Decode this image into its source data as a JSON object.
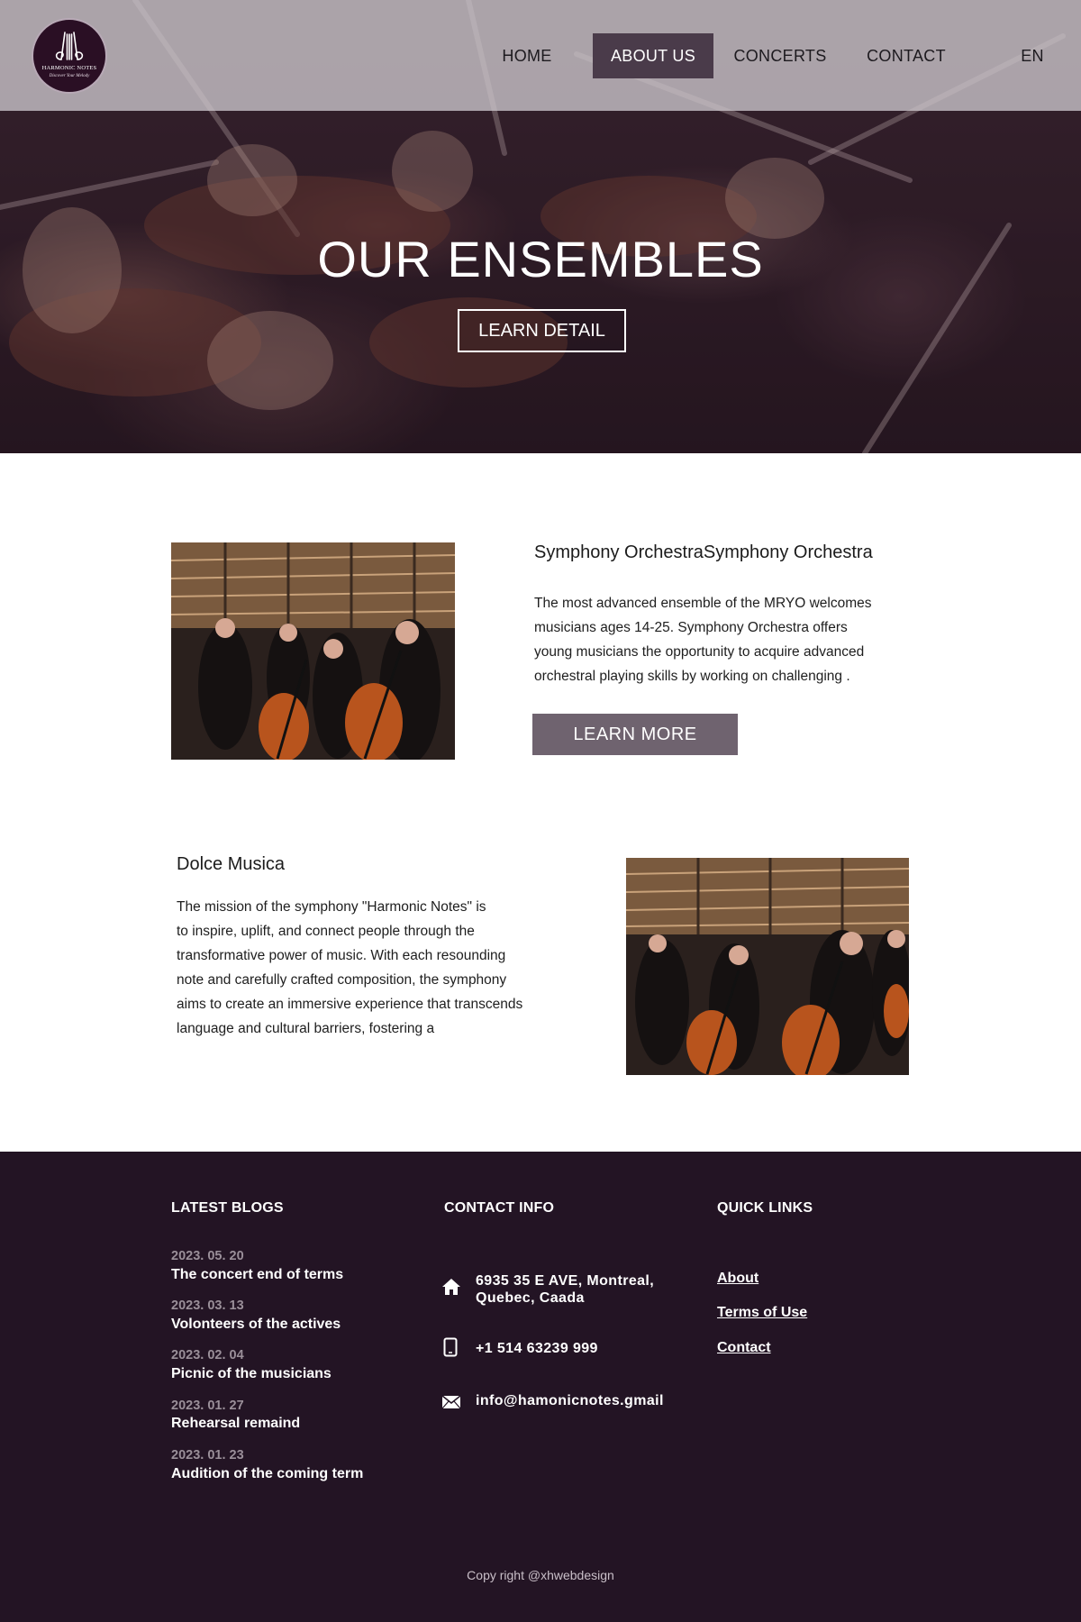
{
  "nav": {
    "logo": {
      "title": "HARMONIC NOTES",
      "tagline": "Discover Your Melody"
    },
    "items": [
      {
        "label": "HOME",
        "active": false
      },
      {
        "label": "ABOUT US",
        "active": true
      },
      {
        "label": "CONCERTS",
        "active": false
      },
      {
        "label": "CONTACT",
        "active": false
      },
      {
        "label": "EN",
        "active": false
      }
    ]
  },
  "hero": {
    "title": "OUR ENSEMBLES",
    "button_label": "LEARN DETAIL"
  },
  "ensembles": [
    {
      "title": "Symphony OrchestraSymphony Orchestra",
      "lines": [
        "The most advanced ensemble of the MRYO welcomes",
        "musicians ages 14-25. Symphony Orchestra offers",
        "young musicians the opportunity to acquire advanced",
        "orchestral playing skills by working on challenging ."
      ],
      "button_label": "LEARN MORE"
    },
    {
      "title": "Dolce Musica",
      "lines": [
        "The mission of the symphony \"Harmonic Notes\" is",
        "to inspire, uplift, and connect people through the",
        "transformative power of music. With each resounding",
        "note and carefully crafted composition, the symphony",
        "aims to create an immersive experience that transcends",
        "language and cultural barriers, fostering a"
      ]
    }
  ],
  "footer": {
    "blogs": {
      "heading": "LATEST BLOGS",
      "items": [
        {
          "date": "2023. 05. 20",
          "title": "The concert end of terms"
        },
        {
          "date": "2023. 03. 13",
          "title": "Volonteers of the actives"
        },
        {
          "date": "2023. 02. 04",
          "title": "Picnic of the musicians"
        },
        {
          "date": "2023. 01. 27",
          "title": "Rehearsal remaind"
        },
        {
          "date": "2023. 01. 23",
          "title": "Audition of the coming term"
        }
      ]
    },
    "contact": {
      "heading": "CONTACT INFO",
      "address_line1": "6935 35 E AVE, Montreal,",
      "address_line2": "Quebec, Caada",
      "phone": "+1 514 63239 999",
      "email": "info@hamonicnotes.gmail"
    },
    "links": {
      "heading": "QUICK LINKS",
      "items": [
        "About",
        "Terms of Use",
        "Contact"
      ]
    },
    "copyright": "Copy right @xhwebdesign"
  }
}
